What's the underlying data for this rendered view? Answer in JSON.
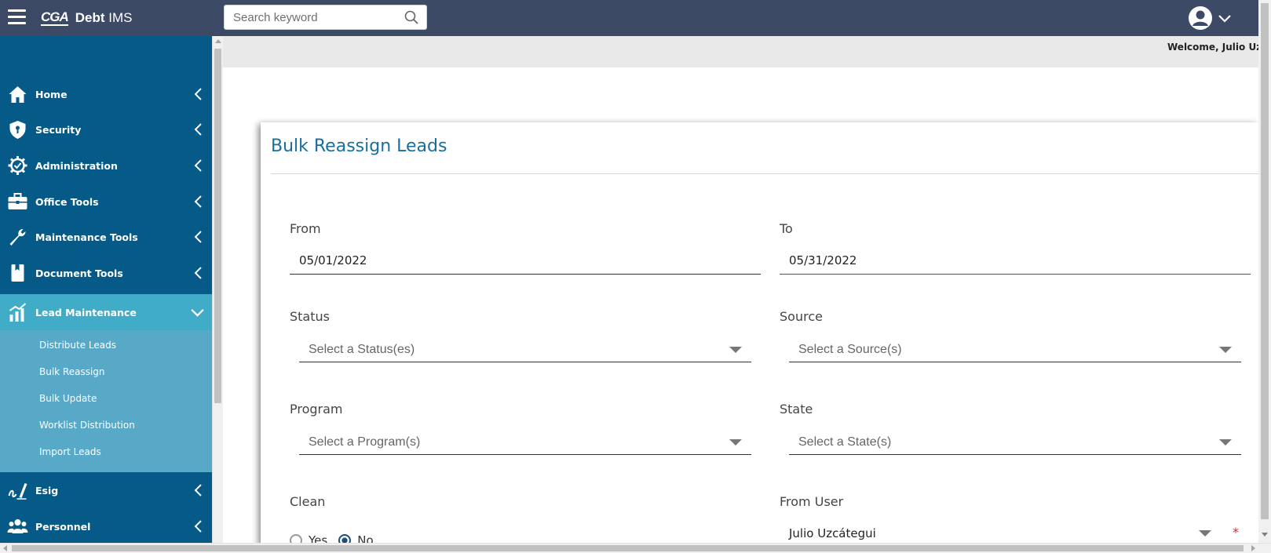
{
  "app": {
    "logo_mark": "CGA",
    "name_bold": "Debt",
    "name_rest": " IMS"
  },
  "search": {
    "placeholder": "Search keyword",
    "value": ""
  },
  "header": {
    "welcome": "Welcome, Julio Uzc"
  },
  "sidebar": {
    "items": [
      {
        "label": "Home",
        "icon": "home-icon"
      },
      {
        "label": "Security",
        "icon": "shield-icon"
      },
      {
        "label": "Administration",
        "icon": "gear-check-icon"
      },
      {
        "label": "Office Tools",
        "icon": "briefcase-icon"
      },
      {
        "label": "Maintenance Tools",
        "icon": "wrench-icon"
      },
      {
        "label": "Document Tools",
        "icon": "book-icon"
      },
      {
        "label": "Lead Maintenance",
        "icon": "chart-icon",
        "expanded": true
      },
      {
        "label": "Esig",
        "icon": "signature-icon"
      },
      {
        "label": "Personnel",
        "icon": "people-icon"
      }
    ],
    "subitems": [
      {
        "label": "Distribute Leads"
      },
      {
        "label": "Bulk Reassign"
      },
      {
        "label": "Bulk Update"
      },
      {
        "label": "Worklist Distribution"
      },
      {
        "label": "Import Leads"
      }
    ]
  },
  "form": {
    "title": "Bulk Reassign Leads",
    "from": {
      "label": "From",
      "value": "05/01/2022"
    },
    "to": {
      "label": "To",
      "value": "05/31/2022"
    },
    "status": {
      "label": "Status",
      "placeholder": "Select a Status(es)"
    },
    "source": {
      "label": "Source",
      "placeholder": "Select a Source(s)"
    },
    "program": {
      "label": "Program",
      "placeholder": "Select a Program(s)"
    },
    "state": {
      "label": "State",
      "placeholder": "Select a State(s)"
    },
    "clean": {
      "label": "Clean",
      "options": [
        "Yes",
        "No"
      ],
      "selected": "No"
    },
    "from_user": {
      "label": "From User",
      "value": "Julio Uzcátegui",
      "required_mark": "*"
    }
  },
  "colors": {
    "topbar": "#3d4a66",
    "sidebar": "#055a87",
    "sidebar_active": "#41acc8",
    "subnav": "#58a9c8",
    "title": "#17709b",
    "required": "#d62d2d"
  }
}
